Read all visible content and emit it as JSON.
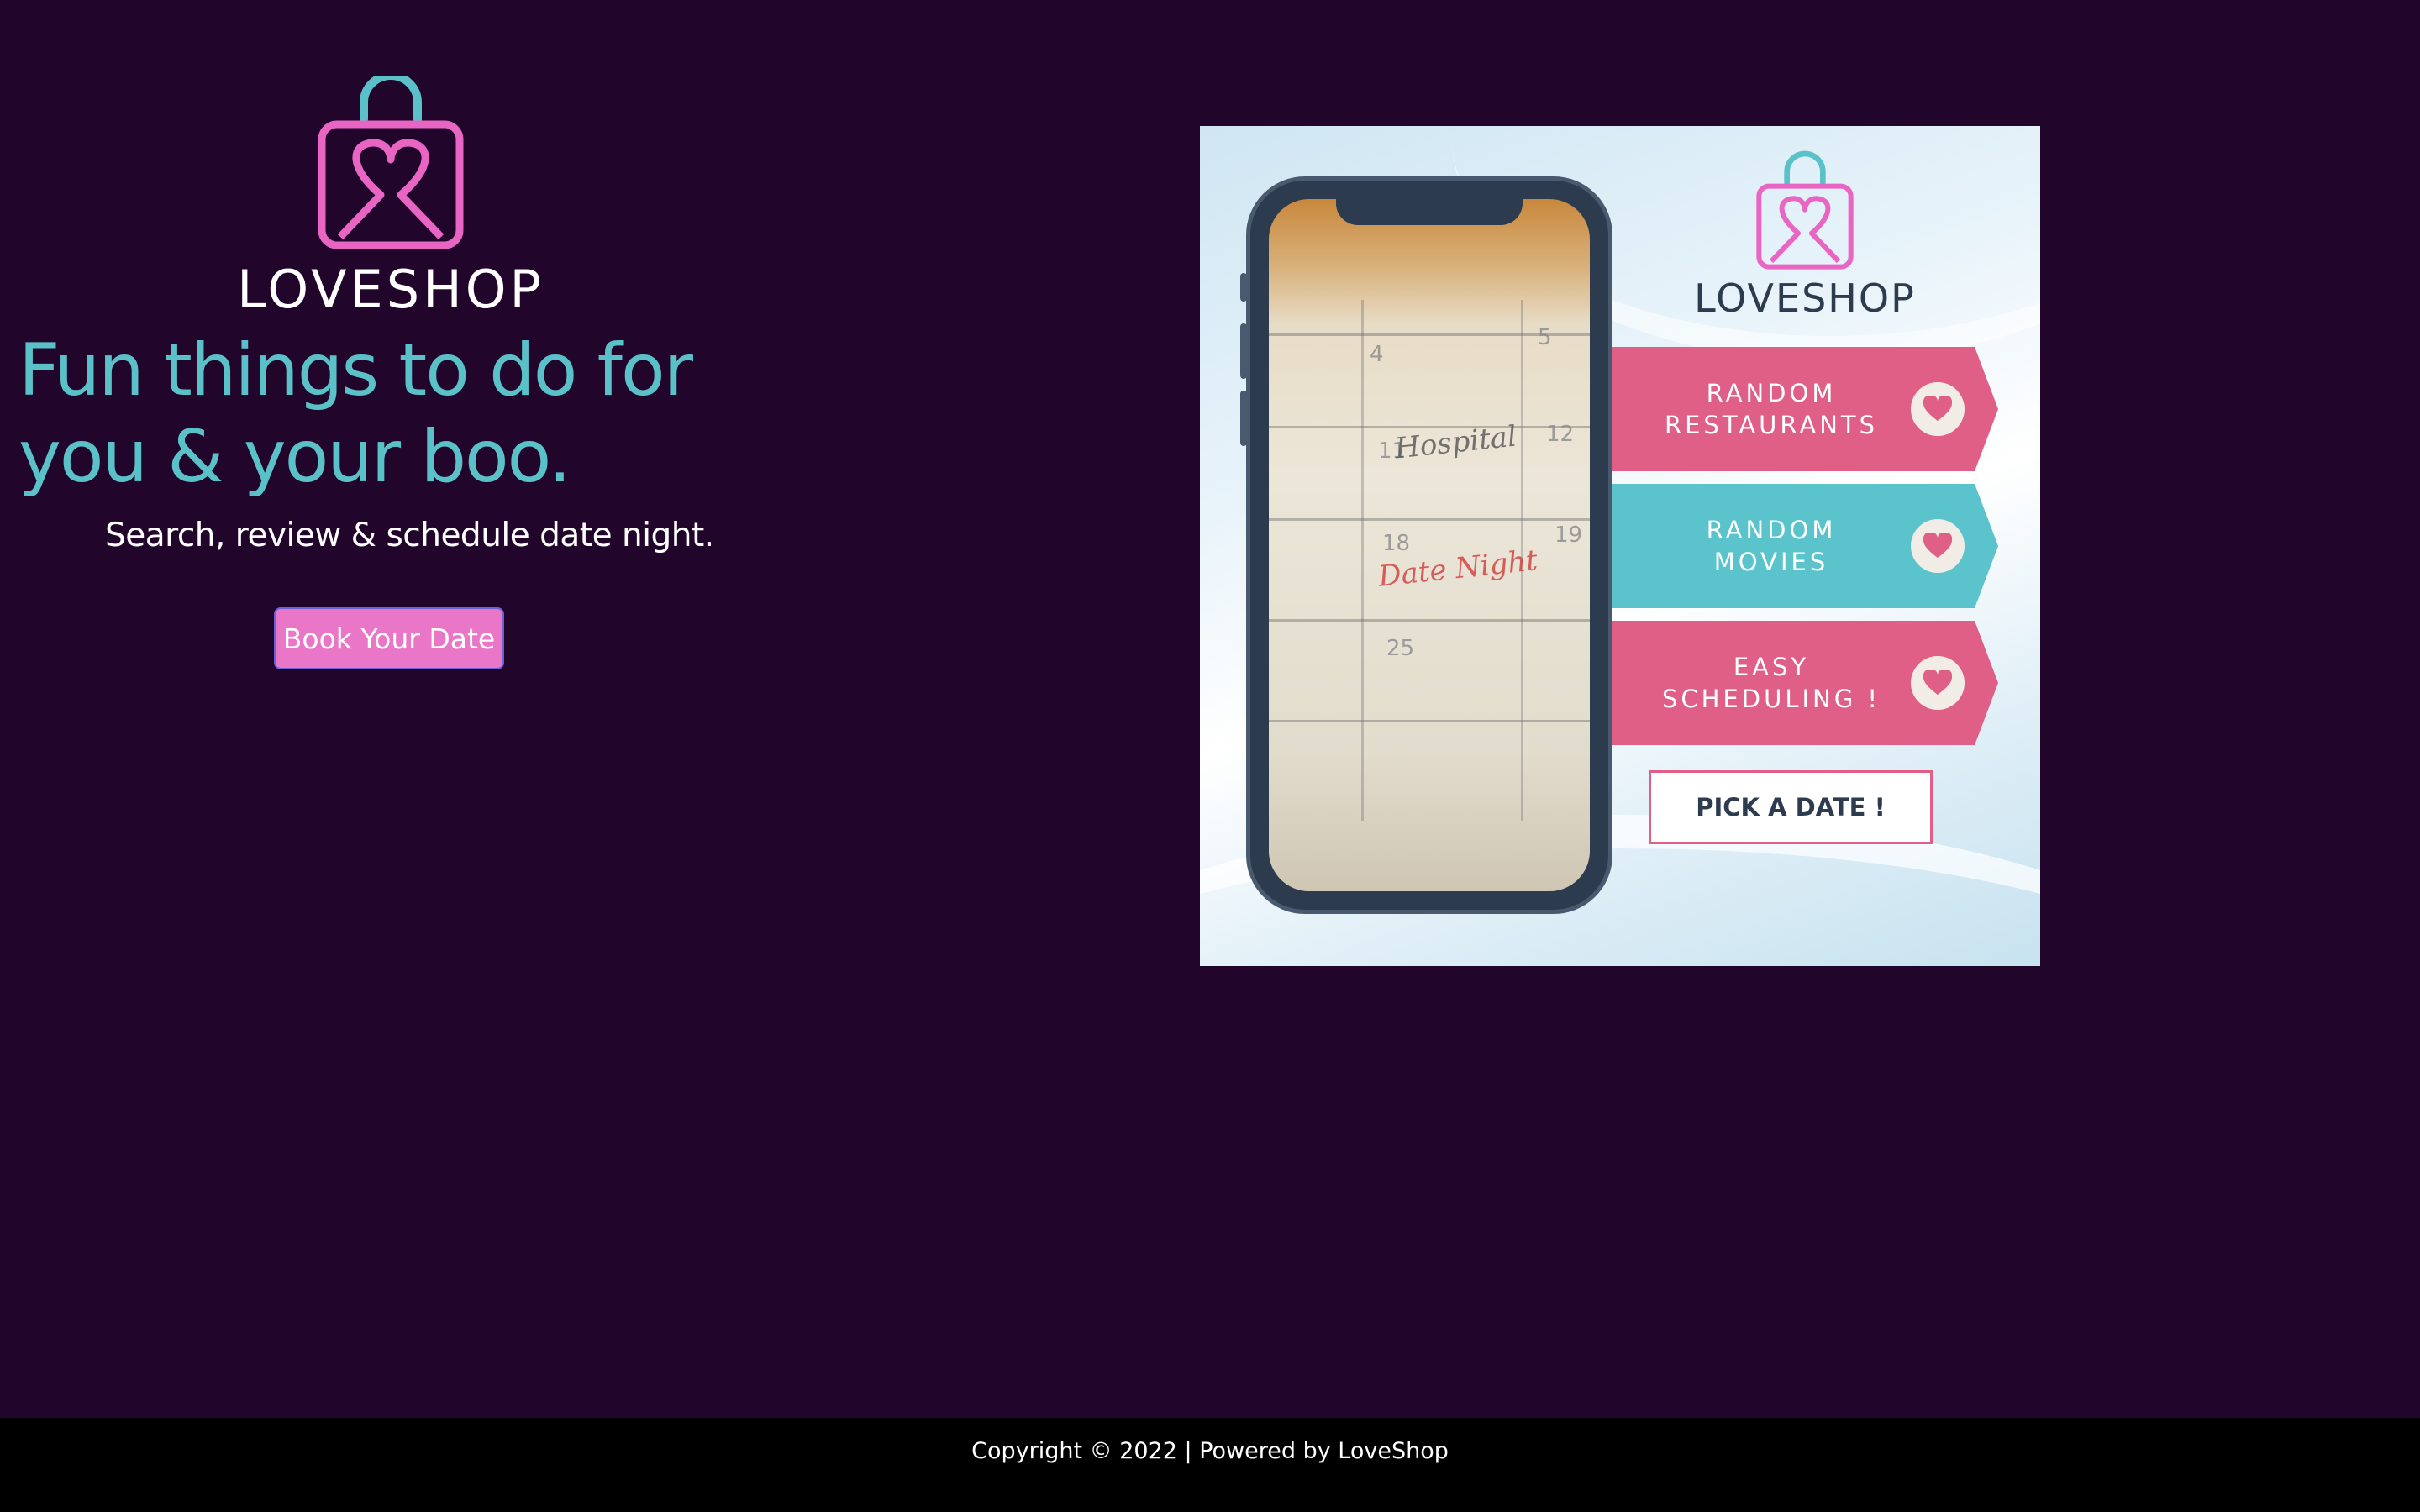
{
  "brand": {
    "name": "LOVESHOP"
  },
  "hero": {
    "headline_line1": "Fun things to do for",
    "headline_line2": "you & your boo.",
    "subheadline": "Search, review & schedule date night.",
    "cta_label": "Book Your Date"
  },
  "promo": {
    "brand": "LOVESHOP",
    "features": [
      {
        "line1": "RANDOM",
        "line2": "RESTAURANTS",
        "color": "#e05f86"
      },
      {
        "line1": "RANDOM",
        "line2": "MOVIES",
        "color": "#5ac3cc"
      },
      {
        "line1": "EASY",
        "line2": "SCHEDULING !",
        "color": "#e05f86"
      }
    ],
    "cta_label": "PICK A DATE !",
    "phone_screen": {
      "numbers": [
        "4",
        "5",
        "11",
        "12",
        "18",
        "19",
        "25"
      ],
      "notes": [
        "Hospital",
        "Date Night"
      ]
    }
  },
  "footer": {
    "copyright": "Copyright © 2022 | Powered by LoveShop"
  },
  "colors": {
    "background": "#22052b",
    "accent_teal": "#5bc1c9",
    "accent_pink": "#ea76c8",
    "footer_bg": "#000000"
  },
  "icons": [
    "shopping-bag-heart-logo-icon",
    "heart-icon"
  ]
}
